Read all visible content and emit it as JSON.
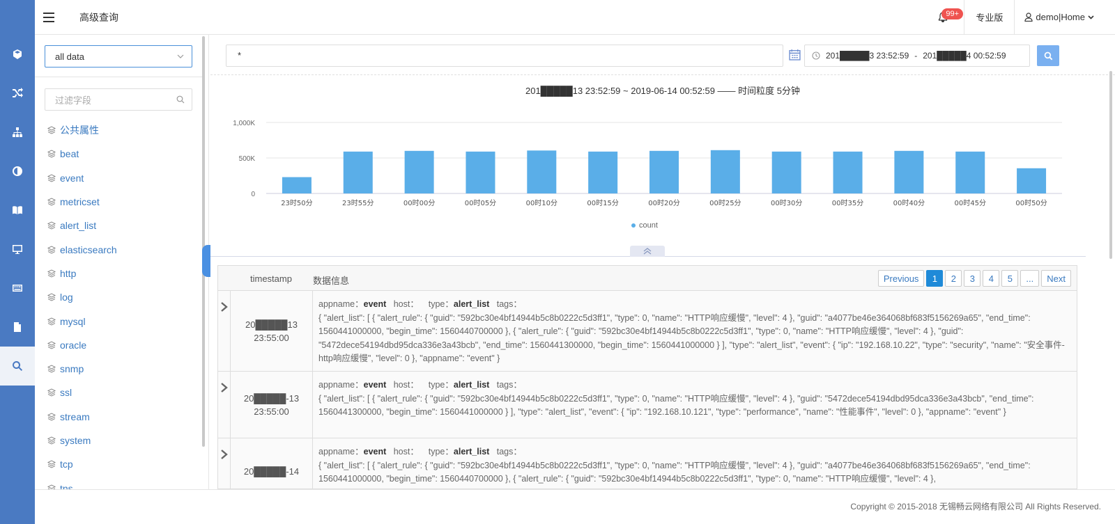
{
  "header": {
    "page_title": "高级查询",
    "notification_badge": "99+",
    "pro_label": "专业版",
    "user_label": "demo|Home"
  },
  "rail": {
    "items": [
      "cube-icon",
      "shuffle-icon",
      "sitemap-icon",
      "half-circle-icon",
      "book-icon",
      "monitor-icon",
      "keyboard-icon",
      "document-icon",
      "search-icon"
    ],
    "active": "search-icon"
  },
  "fields": {
    "source_select": "all data",
    "filter_placeholder": "过滤字段",
    "items": [
      "公共属性",
      "beat",
      "event",
      "metricset",
      "alert_list",
      "elasticsearch",
      "http",
      "log",
      "mysql",
      "oracle",
      "snmp",
      "ssl",
      "stream",
      "system",
      "tcp",
      "tns"
    ]
  },
  "query": {
    "value": "*",
    "time_start": "201█████3 23:52:59",
    "time_sep": "-",
    "time_end": "201█████4 00:52:59"
  },
  "chart_title": "201█████13 23:52:59 ~ 2019-06-14 00:52:59 —— 时间粒度 5分钟",
  "chart_data": {
    "type": "bar",
    "categories": [
      "23时50分",
      "23时55分",
      "00时00分",
      "00时05分",
      "00时10分",
      "00时15分",
      "00时20分",
      "00时25分",
      "00时30分",
      "00时35分",
      "00时40分",
      "00时45分",
      "00时50分"
    ],
    "series": [
      {
        "name": "count",
        "values": [
          230000,
          590000,
          600000,
          590000,
          605000,
          590000,
          600000,
          610000,
          590000,
          590000,
          600000,
          590000,
          355000
        ]
      }
    ],
    "ylim": [
      0,
      1000000
    ],
    "ytick_labels": [
      "0",
      "500K",
      "1,000K"
    ],
    "grid": true,
    "legend": "bottom",
    "color": "#5aaee8"
  },
  "results": {
    "col_timestamp": "timestamp",
    "col_info": "数据信息",
    "pager": [
      "Previous",
      "1",
      "2",
      "3",
      "4",
      "5",
      "...",
      "Next"
    ],
    "active_page": "1",
    "rows": [
      {
        "date": "20█████13",
        "time": "23:55:00",
        "appname": "event",
        "type": "alert_list",
        "body": "{ \"alert_list\": [ { \"alert_rule\": { \"guid\": \"592bc30e4bf14944b5c8b0222c5d3ff1\", \"type\": 0, \"name\": \"HTTP响应缓慢\", \"level\": 4 }, \"guid\": \"a4077be46e364068bf683f5156269a65\", \"end_time\": 1560441000000, \"begin_time\": 1560440700000 }, { \"alert_rule\": { \"guid\": \"592bc30e4bf14944b5c8b0222c5d3ff1\", \"type\": 0, \"name\": \"HTTP响应缓慢\", \"level\": 4 }, \"guid\": \"5472dece54194dbd95dca336e3a43bcb\", \"end_time\": 1560441300000, \"begin_time\": 1560441000000 } ], \"type\": \"alert_list\", \"event\": { \"ip\": \"192.168.10.22\", \"type\": \"security\", \"name\": \"安全事件-http响应缓慢\", \"level\": 0 }, \"appname\": \"event\" }"
      },
      {
        "date": "20█████-13",
        "time": "23:55:00",
        "appname": "event",
        "type": "alert_list",
        "body": "{ \"alert_list\": [ { \"alert_rule\": { \"guid\": \"592bc30e4bf14944b5c8b0222c5d3ff1\", \"type\": 0, \"name\": \"HTTP响应缓慢\", \"level\": 4 }, \"guid\": \"5472dece54194dbd95dca336e3a43bcb\", \"end_time\": 1560441300000, \"begin_time\": 1560441000000 } ], \"type\": \"alert_list\", \"event\": { \"ip\": \"192.168.10.121\", \"type\": \"performance\", \"name\": \"性能事件\", \"level\": 0 }, \"appname\": \"event\" }"
      },
      {
        "date": "20█████-14",
        "time": "",
        "appname": "event",
        "type": "alert_list",
        "body": "{ \"alert_list\": [ { \"alert_rule\": { \"guid\": \"592bc30e4bf14944b5c8b0222c5d3ff1\", \"type\": 0, \"name\": \"HTTP响应缓慢\", \"level\": 4 }, \"guid\": \"a4077be46e364068bf683f5156269a65\", \"end_time\": 1560441000000, \"begin_time\": 1560440700000 }, { \"alert_rule\": { \"guid\": \"592bc30e4bf14944b5c8b0222c5d3ff1\", \"type\": 0, \"name\": \"HTTP响应缓慢\", \"level\": 4 },"
      }
    ],
    "labels": {
      "appname": "appname：",
      "host": "host：",
      "type": "type：",
      "tags": "tags："
    }
  },
  "footer": "Copyright © 2015-2018 无锡畅云网络有限公司 All Rights Reserved."
}
